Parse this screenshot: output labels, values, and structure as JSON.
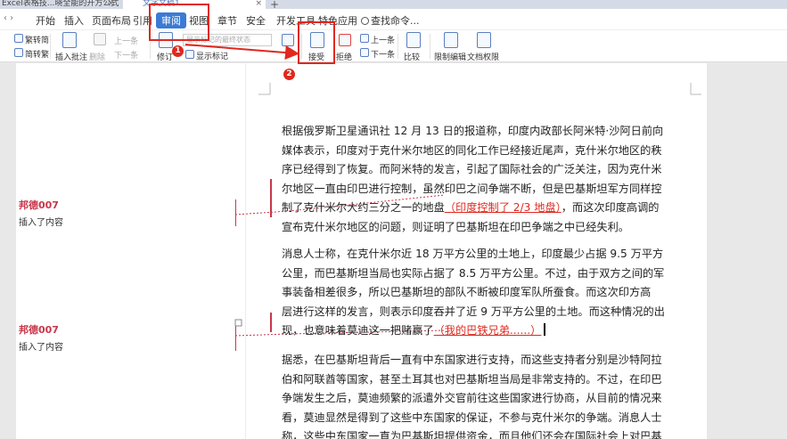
{
  "titlebar": {
    "tabs": [
      {
        "label": "Excel表格技...晓全能的开方公式"
      },
      {
        "label": "文字文稿1"
      }
    ],
    "new_tab": "+",
    "close": "×"
  },
  "menubar": {
    "nav_arrows": "‹ ›",
    "items": [
      "开始",
      "插入",
      "页面布局",
      "引用",
      "审阅",
      "视图",
      "章节",
      "安全",
      "开发工具",
      "特色应用"
    ],
    "active_item": "审阅",
    "search_label": "查找命令..."
  },
  "toolbar": {
    "trad_to_simp": "繁转简",
    "simp_to_trad": "简转繁",
    "insert_comment": "插入批注",
    "delete": "删除",
    "prev_comment": "上一条",
    "next_comment": "下一条",
    "track_changes": "修订",
    "show_markup_mode": "显示标记的最终状态",
    "show_markup": "显示标记",
    "accept": "接受",
    "reject": "拒绝",
    "prev_change": "上一条",
    "next_change": "下一条",
    "compare": "比较",
    "restrict_editing": "限制编辑",
    "document_permissions": "文档权限"
  },
  "annotations": {
    "badge_1": "1",
    "badge_2": "2"
  },
  "comments": [
    {
      "author": "邦德007",
      "description": "插入了内容"
    },
    {
      "author": "邦德007",
      "description": "插入了内容"
    }
  ],
  "document": {
    "p1_lines": [
      "根据俄罗斯卫星通讯社 12 月 13 日的报道称，印度内政部长阿米特·沙阿日前向",
      "媒体表示，印度对于克什米尔地区的同化工作已经接近尾声，克什米尔地区的秩",
      "序已经得到了恢复。而阿米特的发言，引起了国际社会的广泛关注，因为克什米",
      "尔地区一直由印巴进行控制，虽然印巴之间争端不断，但是巴基斯坦军方同样控"
    ],
    "p1_line5_before": "制了克什米尔大约三分之一的地盘",
    "p1_line5_insert": "（印度控制了 2/3 地盘）",
    "p1_line5_after": "，而这次印度高调的",
    "p1_line6": "宣布克什米尔地区的问题，则证明了巴基斯坦在印巴争端之中已经失利。",
    "p2_lines": [
      "消息人士称，在克什米尔近 18 万平方公里的土地上，印度最少占据 9.5 万平方",
      "公里，而巴基斯坦当局也实际占据了 8.5 万平方公里。不过，由于双方之间的军",
      "事装备相差很多，所以巴基斯坦的部队不断被印度军队所蚕食。而这次印方高",
      "层进行这样的发言，则表示印度吞并了近 9 万平方公里的土地。而这种情况的出"
    ],
    "p2_line5_before": "现，也意味着莫迪这一把赌赢了",
    "p2_line5_insert": "（我的巴铁兄弟......）",
    "p3_lines": [
      "据悉，在巴基斯坦背后一直有中东国家进行支持，而这些支持者分别是沙特阿拉",
      "伯和阿联酋等国家，甚至土耳其也对巴基斯坦当局是非常支持的。不过，在印巴",
      "争端发生之后，莫迪频繁的派遣外交官前往这些国家进行协商，从目前的情况来",
      "看，莫迪显然是得到了这些中东国家的保证，不参与克什米尔的争端。消息人士",
      "称，这些中东国家一直为巴基斯坦提供资金，而且他们还会在国际社会上对巴基"
    ]
  },
  "colors": {
    "accent": "#3b7bd4",
    "revision": "#e0281e",
    "comment_author": "#c8374a"
  }
}
